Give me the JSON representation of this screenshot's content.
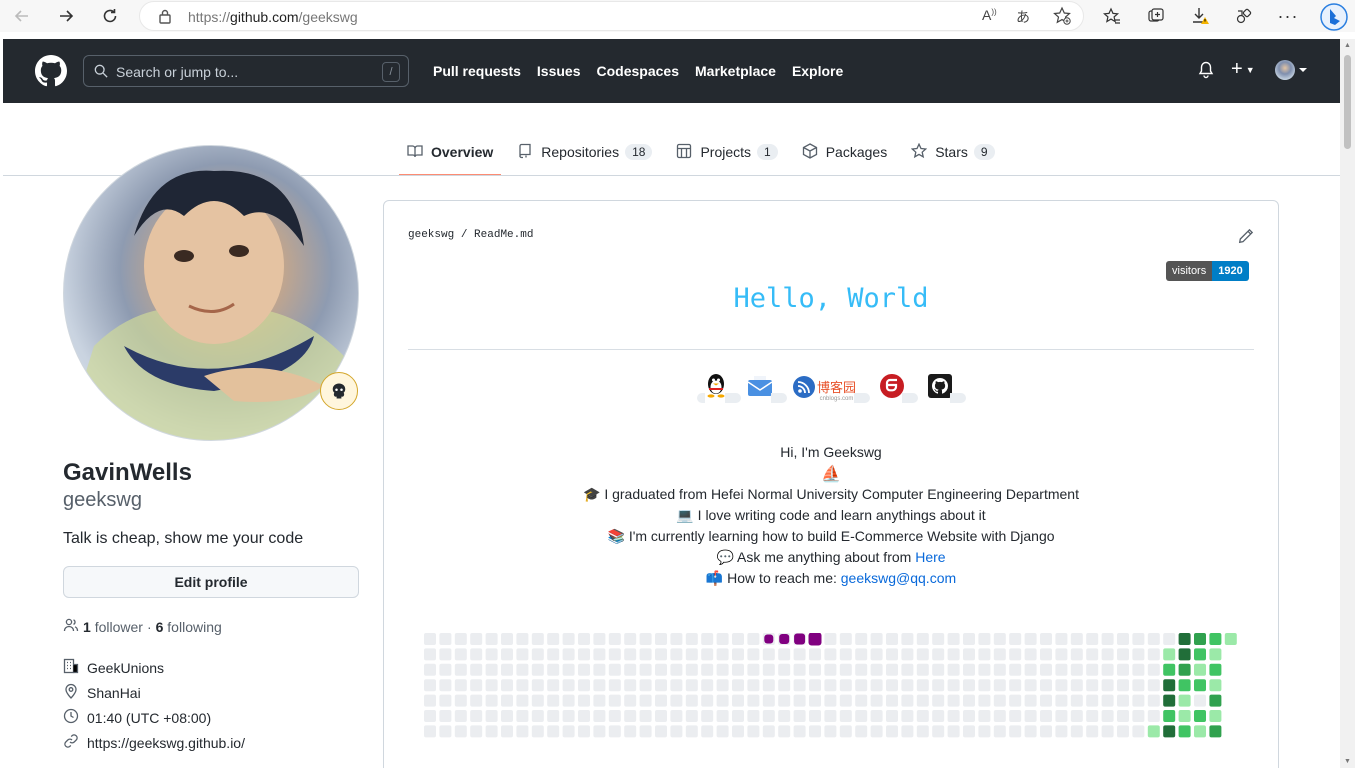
{
  "browser": {
    "url_scheme": "https://",
    "url_host": "github.com",
    "url_path": "/geekswg",
    "read_aloud": "A",
    "translate": "あ"
  },
  "header": {
    "search_placeholder": "Search or jump to...",
    "search_shortcut": "/",
    "nav": [
      "Pull requests",
      "Issues",
      "Codespaces",
      "Marketplace",
      "Explore"
    ],
    "plus_icon": "+"
  },
  "tabs": [
    {
      "label": "Overview",
      "count": null,
      "icon": "book-icon",
      "selected": true
    },
    {
      "label": "Repositories",
      "count": "18",
      "icon": "repo-icon"
    },
    {
      "label": "Projects",
      "count": "1",
      "icon": "project-icon"
    },
    {
      "label": "Packages",
      "count": null,
      "icon": "package-icon"
    },
    {
      "label": "Stars",
      "count": "9",
      "icon": "star-icon"
    }
  ],
  "profile": {
    "full_name": "GavinWells",
    "login": "geekswg",
    "bio": "Talk is cheap, show me your code",
    "edit_label": "Edit profile",
    "followers_count": "1",
    "followers_label": "follower",
    "dot": "·",
    "following_count": "6",
    "following_label": "following",
    "company": "GeekUnions",
    "location": "ShanHai",
    "time": "01:40 (UTC +08:00)",
    "website": "https://geekswg.github.io/"
  },
  "readme": {
    "crumb_user": "geekswg",
    "crumb_sep": "/",
    "crumb_file": "ReadMe.md",
    "visitors_label": "visitors",
    "visitors_count": "1920",
    "hello": "Hello, World",
    "cnblogs_text": "博客园",
    "cnblogs_sub": "cnblogs.com",
    "lines": {
      "l1": "Hi, I'm Geekswg",
      "l2_icon": "⛵",
      "l3_icon": "🎓",
      "l3": "I graduated from Hefei Normal University Computer Engineering Department",
      "l4_icon": "💻",
      "l4": "I love writing code and learn anythings about it",
      "l5_icon": "📚",
      "l5": "I'm currently learning how to build E-Commerce Website with Django",
      "l6_icon": "💬",
      "l6": "Ask me anything about from",
      "l6_link": "Here",
      "l7_icon": "📫",
      "l7": "How to reach me:",
      "l7_link": "geekswg@qq.com"
    }
  },
  "colors": {
    "header_bg": "#24292f",
    "hello": "#36bcf7",
    "link": "#0969da",
    "snake": "#800080",
    "contrib_levels": [
      "#ebedf0",
      "#9be9a8",
      "#40c463",
      "#30a14e",
      "#216e39"
    ]
  }
}
